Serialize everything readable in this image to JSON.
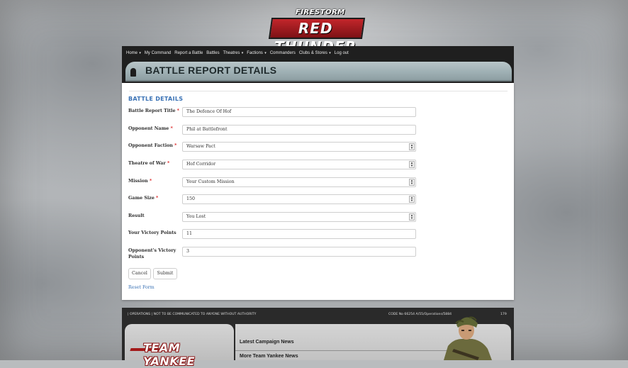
{
  "logo": {
    "top": "FIRESTORM",
    "main": "RED THUNDER"
  },
  "nav": [
    {
      "label": "Home",
      "caret": true
    },
    {
      "label": "My Command",
      "caret": false
    },
    {
      "label": "Report a Battle",
      "caret": false
    },
    {
      "label": "Battles",
      "caret": false
    },
    {
      "label": "Theatres",
      "caret": true
    },
    {
      "label": "Factions",
      "caret": true
    },
    {
      "label": "Commanders",
      "caret": false
    },
    {
      "label": "Clubs & Stores",
      "caret": true
    },
    {
      "label": "Log out",
      "caret": false
    }
  ],
  "page_title": "BATTLE REPORT DETAILS",
  "form": {
    "section_title": "BATTLE DETAILS",
    "fields": [
      {
        "label": "Battle Report Title",
        "required": true,
        "type": "text",
        "value": "The Defence Of Hof"
      },
      {
        "label": "Opponent Name",
        "required": true,
        "type": "text",
        "value": "Phil at Battlefront"
      },
      {
        "label": "Opponent Faction",
        "required": true,
        "type": "select",
        "value": "Warsaw Pact"
      },
      {
        "label": "Theatre of War",
        "required": true,
        "type": "select",
        "value": "Hof Corridor"
      },
      {
        "label": "Mission",
        "required": true,
        "type": "select",
        "value": "Your Custom Mission"
      },
      {
        "label": "Game Size",
        "required": true,
        "type": "select",
        "value": "150"
      },
      {
        "label": "Result",
        "required": false,
        "type": "select",
        "value": "You Lost"
      },
      {
        "label": "Your Victory Points",
        "required": false,
        "type": "text",
        "value": "11"
      },
      {
        "label": "Opponent's Victory Points",
        "required": false,
        "type": "text",
        "value": "3"
      }
    ],
    "required_marker": "*",
    "cancel_label": "Cancel",
    "submit_label": "Submit",
    "reset_label": "Reset Form"
  },
  "footer": {
    "strip_left": "| OPERATIONS | NOT TO BE COMMUNICATED TO ANYONE WITHOUT AUTHORITY",
    "strip_code": "CODE No 66254 A/55/Operations/5884",
    "strip_num": "179",
    "brand": "TEAM YANKEE",
    "news": [
      "Latest Campaign News",
      "More Team Yankee News"
    ]
  },
  "colors": {
    "accent_blue": "#3a72b5",
    "nav_bg": "#1f1f1f",
    "required_red": "#dd2222",
    "logo_red": "#c2262b"
  }
}
